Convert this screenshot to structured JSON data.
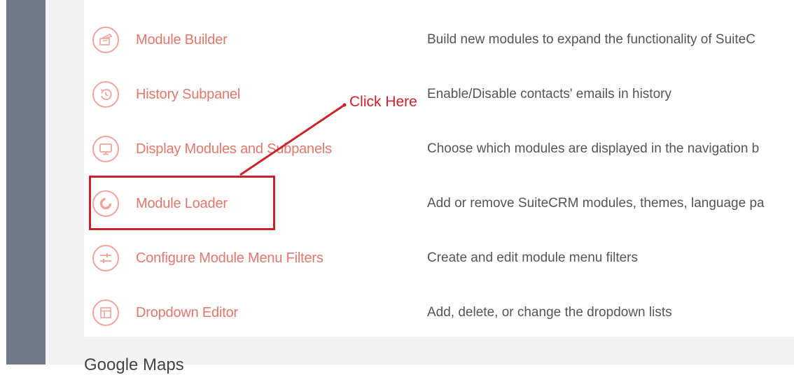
{
  "rows": [
    {
      "icon": "module-builder-icon",
      "title": "Module Builder",
      "description": "Build new modules to expand the functionality of SuiteC"
    },
    {
      "icon": "history-icon",
      "title": "History Subpanel",
      "description": "Enable/Disable contacts' emails in history"
    },
    {
      "icon": "monitor-icon",
      "title": "Display Modules and Subpanels",
      "description": "Choose which modules are displayed in the navigation b"
    },
    {
      "icon": "loader-icon",
      "title": "Module Loader",
      "description": "Add or remove SuiteCRM modules, themes, language pa"
    },
    {
      "icon": "sliders-icon",
      "title": "Configure Module Menu Filters",
      "description": "Create and edit module menu filters"
    },
    {
      "icon": "table-icon",
      "title": "Dropdown Editor",
      "description": "Add, delete, or change the dropdown lists"
    }
  ],
  "annotation": {
    "label": "Click Here",
    "color": "#cc2229"
  },
  "bottom_section": {
    "title": "Google Maps"
  },
  "colors": {
    "link": "#e0786c",
    "icon_ring": "#f0a49c",
    "sidebar": "#6f7a86",
    "text": "#555555"
  }
}
